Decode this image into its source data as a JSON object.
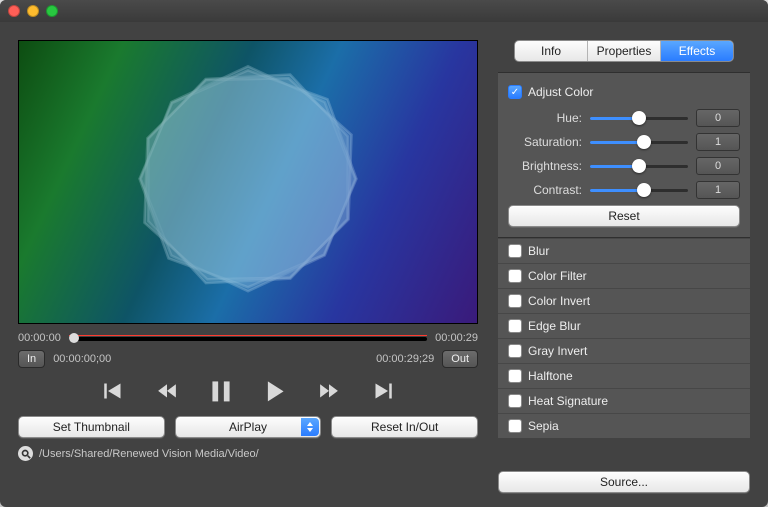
{
  "tabs": {
    "info": "Info",
    "properties": "Properties",
    "effects": "Effects",
    "active": "effects"
  },
  "time": {
    "start": "00:00:00",
    "end": "00:00:29",
    "in_tc": "00:00:00;00",
    "out_tc": "00:00:29;29",
    "in_btn": "In",
    "out_btn": "Out"
  },
  "buttons": {
    "thumbnail": "Set Thumbnail",
    "airplay": "AirPlay",
    "reset_inout": "Reset In/Out",
    "reset": "Reset",
    "source": "Source..."
  },
  "path": "/Users/Shared/Renewed Vision Media/Video/",
  "adjust": {
    "title": "Adjust Color",
    "enabled": true,
    "rows": [
      {
        "label": "Hue:",
        "value": "0",
        "pos": 0.5
      },
      {
        "label": "Saturation:",
        "value": "1",
        "pos": 0.55
      },
      {
        "label": "Brightness:",
        "value": "0",
        "pos": 0.5
      },
      {
        "label": "Contrast:",
        "value": "1",
        "pos": 0.55
      }
    ]
  },
  "effects": [
    {
      "label": "Blur",
      "on": false
    },
    {
      "label": "Color Filter",
      "on": false
    },
    {
      "label": "Color Invert",
      "on": false
    },
    {
      "label": "Edge Blur",
      "on": false
    },
    {
      "label": "Gray Invert",
      "on": false
    },
    {
      "label": "Halftone",
      "on": false
    },
    {
      "label": "Heat Signature",
      "on": false
    },
    {
      "label": "Sepia",
      "on": false
    }
  ]
}
